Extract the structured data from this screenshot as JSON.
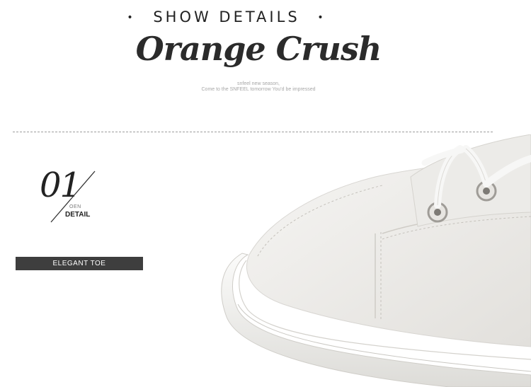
{
  "header": {
    "title": "SHOW DETAILS",
    "dot": "•",
    "brand": "Orange Crush",
    "subtitle_line1": "snfeel new season,",
    "subtitle_line2": "Come to the SNFEEL tomorrow  You'd be impressed"
  },
  "detail_label": {
    "number": "01",
    "small_text": "OEN",
    "big_text": "DETAIL"
  },
  "feature_badge": "ELEGANT TOE",
  "colors": {
    "badge_background": "#3e3e3e",
    "text_dark": "#2b2b2b",
    "shoe_white": "#f4f3f1"
  },
  "image": {
    "name": "white-sneaker-toe-photo"
  }
}
